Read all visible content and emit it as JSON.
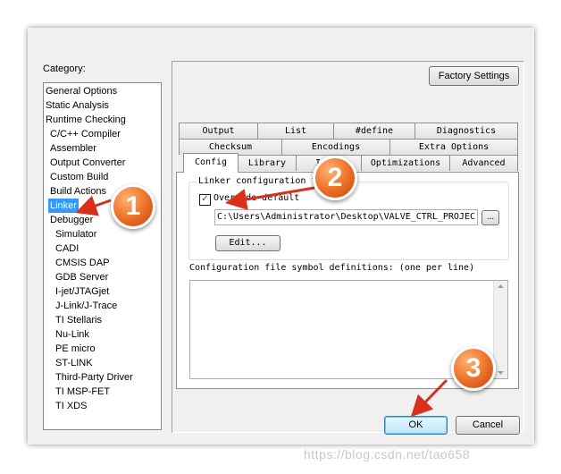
{
  "category": {
    "label": "Category:",
    "items": [
      {
        "label": "General Options",
        "indent": false,
        "selected": false
      },
      {
        "label": "Static Analysis",
        "indent": false,
        "selected": false
      },
      {
        "label": "Runtime Checking",
        "indent": false,
        "selected": false
      },
      {
        "label": "C/C++ Compiler",
        "indent": true,
        "selected": false
      },
      {
        "label": "Assembler",
        "indent": true,
        "selected": false
      },
      {
        "label": "Output Converter",
        "indent": true,
        "selected": false
      },
      {
        "label": "Custom Build",
        "indent": true,
        "selected": false
      },
      {
        "label": "Build Actions",
        "indent": true,
        "selected": false
      },
      {
        "label": "Linker",
        "indent": true,
        "selected": true
      },
      {
        "label": "Debugger",
        "indent": true,
        "selected": false
      },
      {
        "label": "Simulator",
        "indent": true,
        "selected": false,
        "deep": true
      },
      {
        "label": "CADI",
        "indent": true,
        "selected": false,
        "deep": true
      },
      {
        "label": "CMSIS DAP",
        "indent": true,
        "selected": false,
        "deep": true
      },
      {
        "label": "GDB Server",
        "indent": true,
        "selected": false,
        "deep": true
      },
      {
        "label": "I-jet/JTAGjet",
        "indent": true,
        "selected": false,
        "deep": true
      },
      {
        "label": "J-Link/J-Trace",
        "indent": true,
        "selected": false,
        "deep": true
      },
      {
        "label": "TI Stellaris",
        "indent": true,
        "selected": false,
        "deep": true
      },
      {
        "label": "Nu-Link",
        "indent": true,
        "selected": false,
        "deep": true
      },
      {
        "label": "PE micro",
        "indent": true,
        "selected": false,
        "deep": true
      },
      {
        "label": "ST-LINK",
        "indent": true,
        "selected": false,
        "deep": true
      },
      {
        "label": "Third-Party Driver",
        "indent": true,
        "selected": false,
        "deep": true
      },
      {
        "label": "TI MSP-FET",
        "indent": true,
        "selected": false,
        "deep": true
      },
      {
        "label": "TI XDS",
        "indent": true,
        "selected": false,
        "deep": true
      }
    ]
  },
  "buttons": {
    "factory": "Factory Settings",
    "ok": "OK",
    "cancel": "Cancel",
    "edit": "Edit...",
    "browse": "..."
  },
  "tabs": {
    "row1": [
      "Output",
      "List",
      "#define",
      "Diagnostics"
    ],
    "row2": [
      "Checksum",
      "Encodings",
      "Extra Options"
    ],
    "row3": [
      "Config",
      "Library",
      "Input",
      "Optimizations",
      "Advanced"
    ],
    "active": "Config"
  },
  "config": {
    "group_title": "Linker configuration file",
    "override_label": "Override default",
    "override_checked": true,
    "path_value": "C:\\Users\\Administrator\\Desktop\\VALVE_CTRL_PROJEC",
    "symbols_label": "Configuration file symbol definitions: (one per line)",
    "symbols_value": ""
  },
  "annotations": {
    "badges": [
      "1",
      "2",
      "3"
    ],
    "color": "#e8501a"
  },
  "watermark": "https://blog.csdn.net/tao658"
}
